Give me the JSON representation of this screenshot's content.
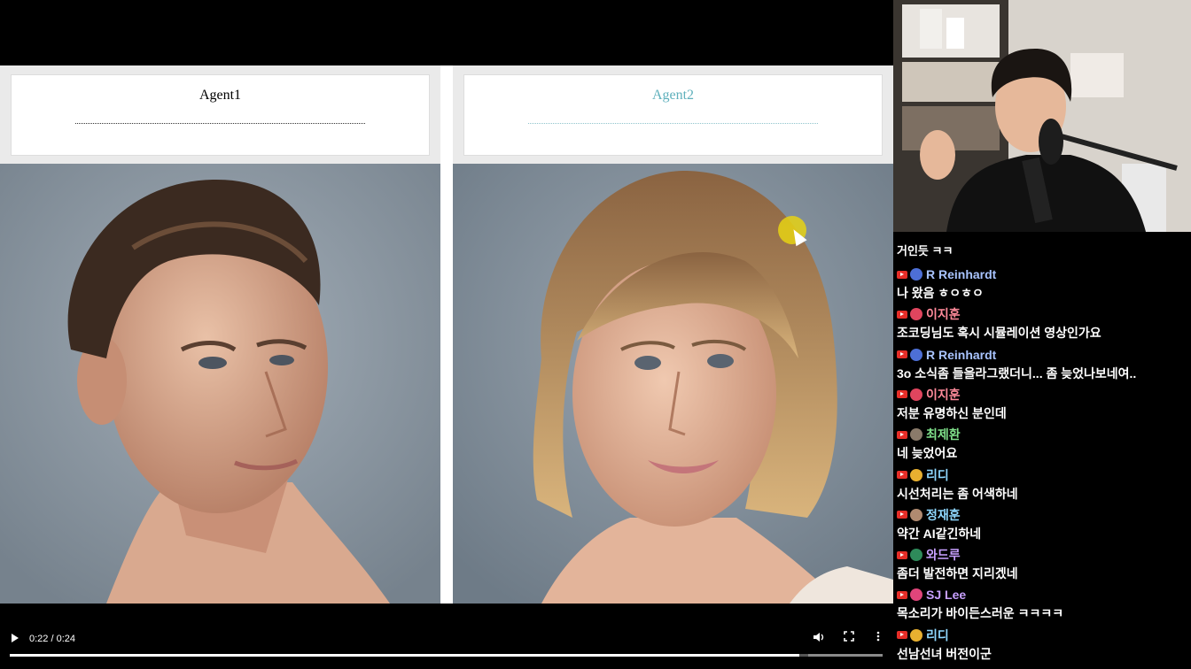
{
  "agents": {
    "left": {
      "title": "Agent1",
      "title_color": "#111111"
    },
    "right": {
      "title": "Agent2",
      "title_color": "#5fb0bc"
    }
  },
  "player": {
    "time": "0:22 / 0:24",
    "progress": 0.905,
    "icons": [
      "play-icon",
      "volume-icon",
      "fullscreen-icon",
      "more-icon"
    ]
  },
  "chat": {
    "partial_top": "거인듯 ㅋㅋ",
    "messages": [
      {
        "author": "R Reinhardt",
        "color": "#a9c4ff",
        "avatar_color": "#4d6fd6",
        "text": "나 왔음 ㅎㅇㅎㅇ"
      },
      {
        "author": "이지훈",
        "color": "#ff8a9a",
        "avatar_color": "#e0455e",
        "text": "조코딩님도 혹시 시뮬레이션 영상인가요"
      },
      {
        "author": "R Reinhardt",
        "color": "#a9c4ff",
        "avatar_color": "#4d6fd6",
        "text": "3o 소식좀 들을라그랬더니... 좀 늦었나보네여.."
      },
      {
        "author": "이지훈",
        "color": "#ff8a9a",
        "avatar_color": "#e0455e",
        "text": "저분 유명하신 분인데"
      },
      {
        "author": "최제환",
        "color": "#7fe08a",
        "avatar_color": "#8a7a6a",
        "text": "네 늦었어요"
      },
      {
        "author": "리디",
        "color": "#8fd8ff",
        "avatar_color": "#e8b030",
        "text": "시선처리는 좀 어색하네"
      },
      {
        "author": "정재훈",
        "color": "#8fd8ff",
        "avatar_color": "#b08a70",
        "text": "약간 AI같긴하네"
      },
      {
        "author": "와드루",
        "color": "#c8a0ff",
        "avatar_color": "#2e8a5a",
        "text": "좀더 발전하면 지리겠네"
      },
      {
        "author": "SJ Lee",
        "color": "#c8a0ff",
        "avatar_color": "#e0457a",
        "text": "목소리가 바이든스러운 ㅋㅋㅋㅋ"
      },
      {
        "author": "리디",
        "color": "#8fd8ff",
        "avatar_color": "#e8b030",
        "text": "선남선녀 버전이군"
      }
    ]
  }
}
